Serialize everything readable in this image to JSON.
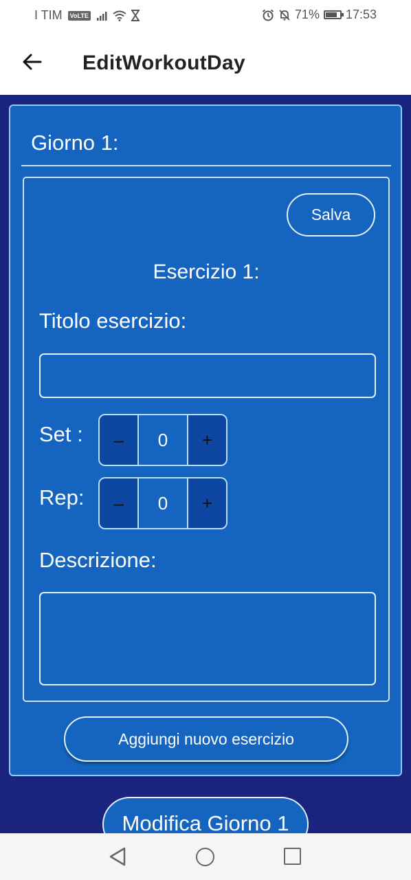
{
  "status_bar": {
    "carrier": "I TIM",
    "volte": "VoLTE",
    "battery_percent": "71%",
    "time": "17:53",
    "icons": [
      "signal-icon",
      "wifi-icon",
      "hourglass-icon",
      "alarm-icon",
      "mute-icon",
      "battery-icon"
    ]
  },
  "app_bar": {
    "title": "EditWorkoutDay",
    "back_icon": "arrow-left-icon"
  },
  "day": {
    "title": "Giorno 1:",
    "exercise": {
      "save_label": "Salva",
      "title": "Esercizio 1:",
      "title_label": "Titolo esercizio:",
      "title_value": "",
      "set_label": "Set :",
      "set_value": "0",
      "rep_label": "Rep:",
      "rep_value": "0",
      "minus": "–",
      "plus": "+",
      "description_label": "Descrizione:",
      "description_value": ""
    },
    "add_exercise_label": "Aggiungi nuovo esercizio"
  },
  "modify_day_label": "Modifica Giorno 1",
  "colors": {
    "background": "#1a237e",
    "card": "#1565c0",
    "stepper_button": "#0d47a1"
  },
  "nav_bar": {
    "icons": [
      "nav-back-icon",
      "nav-home-icon",
      "nav-recents-icon"
    ]
  }
}
